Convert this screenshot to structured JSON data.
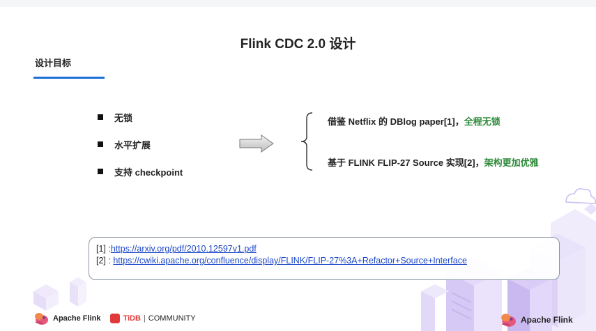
{
  "slide": {
    "title": "Flink CDC 2.0 设计",
    "subtitle": "设计目标"
  },
  "bullets": [
    "无锁",
    "水平扩展",
    "支持 checkpoint"
  ],
  "points": [
    {
      "text": "借鉴 Netflix 的 DBlog  paper[1]，",
      "highlight": "全程无锁"
    },
    {
      "text": "基于 FLINK FLIP-27 Source 实现[2]，",
      "highlight": "架构更加优雅"
    }
  ],
  "references": [
    {
      "prefix": "[1] :",
      "link": "https://arxiv.org/pdf/2010.12597v1.pdf"
    },
    {
      "prefix": "[2] : ",
      "link": "https://cwiki.apache.org/confluence/display/FLINK/FLIP-27%3A+Refactor+Source+Interface"
    }
  ],
  "footer": {
    "left_brand": "Apache Flink",
    "tidb_label": "TiDB",
    "separator": "|",
    "community_label": "COMMUNITY",
    "right_brand": "Apache Flink"
  },
  "colors": {
    "accent_blue": "#1f6fd9",
    "highlight_green": "#2e8b3a",
    "link_blue": "#1a46c8"
  },
  "icons": [
    "squirrel-logo-icon",
    "tidb-logo-icon",
    "arrow-right-icon",
    "curly-brace-icon"
  ]
}
